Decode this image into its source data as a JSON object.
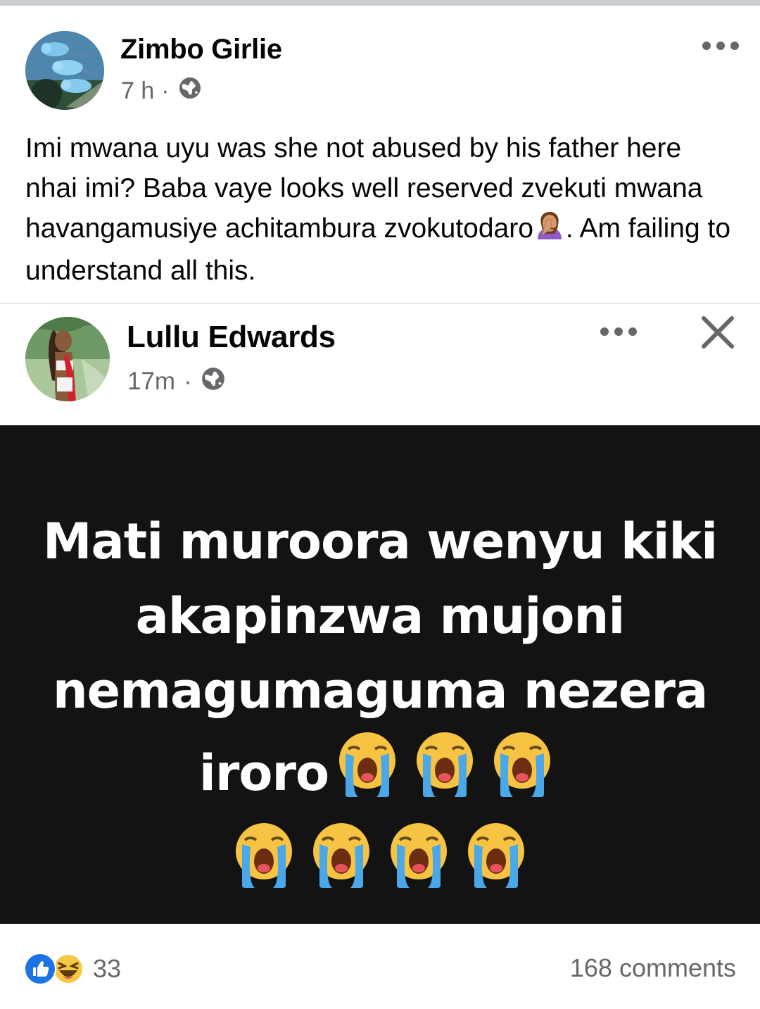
{
  "post": {
    "author": "Zimbo Girlie",
    "time": "7 h",
    "separator": "·",
    "text_part1": "Imi mwana uyu was she not abused by his father here nhai imi? Baba vaye looks well reserved zvekuti mwana havangamusiye achitambura zvokutodaro",
    "text_part2": ". Am failing to understand all this."
  },
  "shared_post": {
    "author": "Lullu Edwards",
    "time": "17m",
    "separator": "·",
    "image_text": "Mati muroora wenyu kiki akapinzwa mujoni nemagumaguma nezera iroro",
    "image_emoji_count": 7
  },
  "footer": {
    "reaction_count": "33",
    "comments": "168 comments"
  },
  "colors": {
    "secondary_text": "#65676b",
    "like_blue": "#1b74e4",
    "image_bg": "#131313"
  },
  "icons": [
    "globe-icon",
    "more-icon",
    "close-icon",
    "facepalm-emoji",
    "crying-emoji",
    "like-reaction-icon",
    "haha-reaction-icon"
  ]
}
